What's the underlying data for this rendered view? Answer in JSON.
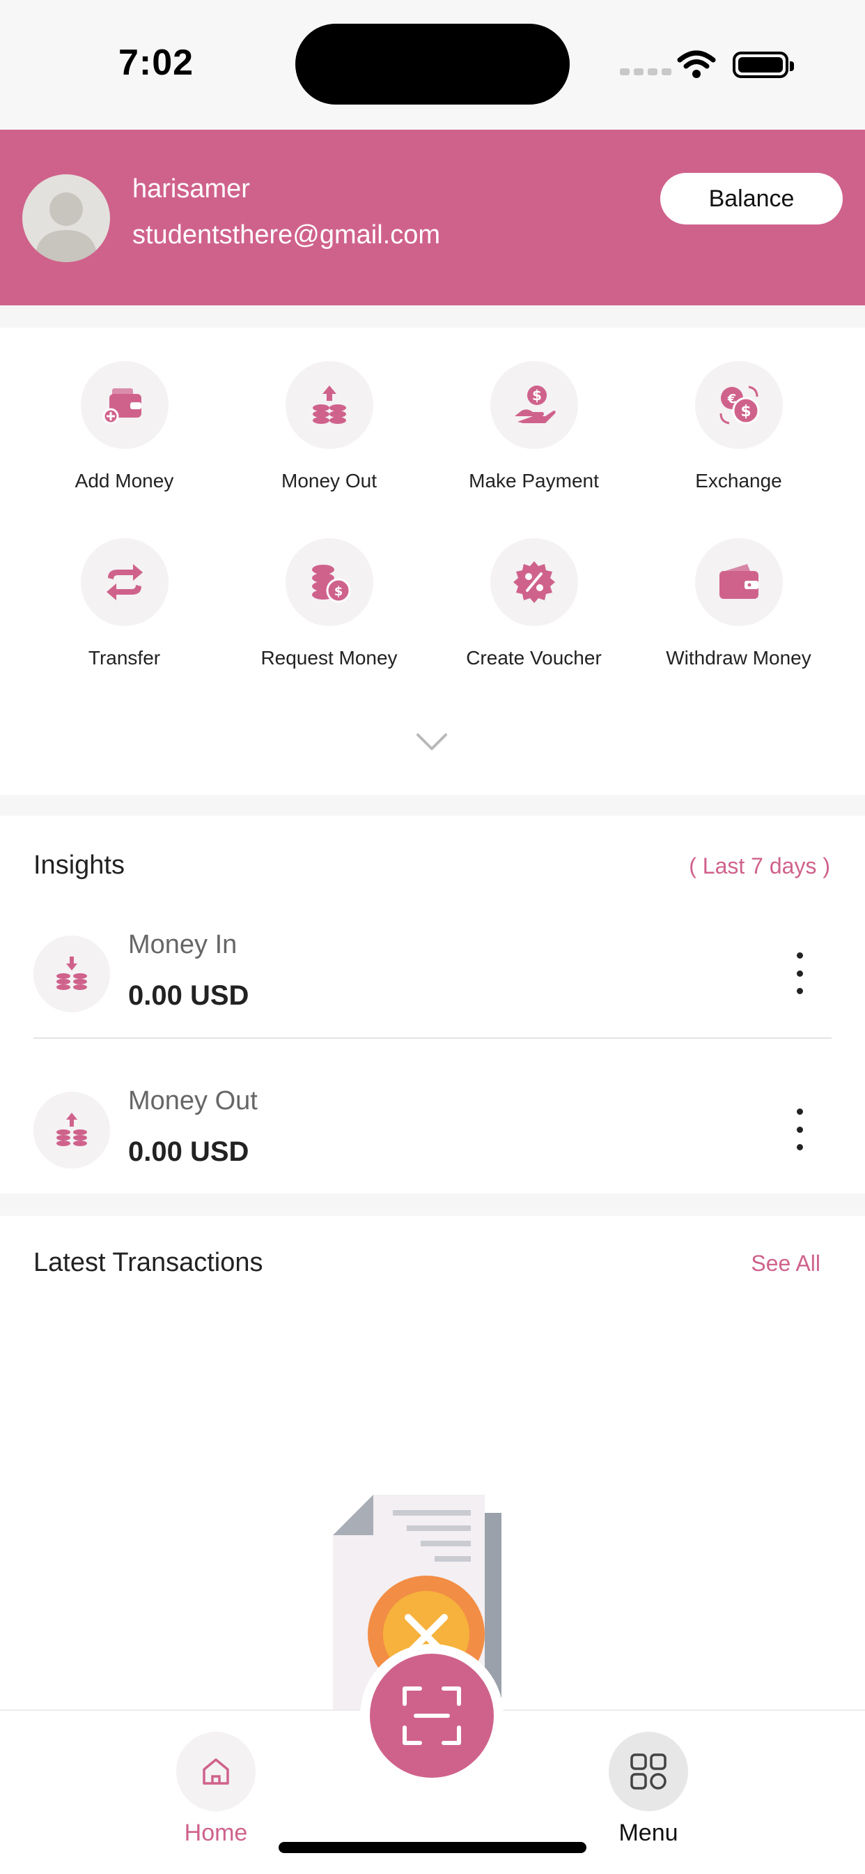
{
  "status_bar": {
    "time": "7:02"
  },
  "profile": {
    "username": "harisamer",
    "email": "studentsthere@gmail.com",
    "balance_label": "Balance"
  },
  "quick_actions": [
    {
      "label": "Add Money",
      "icon": "wallet-add-icon"
    },
    {
      "label": "Money Out",
      "icon": "coins-up-icon"
    },
    {
      "label": "Make Payment",
      "icon": "hand-dollar-icon"
    },
    {
      "label": "Exchange",
      "icon": "currency-exchange-icon"
    },
    {
      "label": "Transfer",
      "icon": "transfer-arrows-icon"
    },
    {
      "label": "Request Money",
      "icon": "coins-dollar-icon"
    },
    {
      "label": "Create Voucher",
      "icon": "percent-badge-icon"
    },
    {
      "label": "Withdraw Money",
      "icon": "wallet-icon"
    }
  ],
  "insights": {
    "title": "Insights",
    "period": "( Last 7 days )",
    "rows": [
      {
        "label": "Money In",
        "value": "0.00 USD",
        "icon": "coins-down-icon"
      },
      {
        "label": "Money Out",
        "value": "0.00 USD",
        "icon": "coins-up-icon"
      }
    ]
  },
  "transactions": {
    "title": "Latest Transactions",
    "see_all": "See All"
  },
  "bottom_nav": {
    "home_label": "Home",
    "menu_label": "Menu"
  },
  "colors": {
    "brand": "#cf628b",
    "icon_bg": "#f4f2f3",
    "page_bg": "#f6f6f6"
  }
}
